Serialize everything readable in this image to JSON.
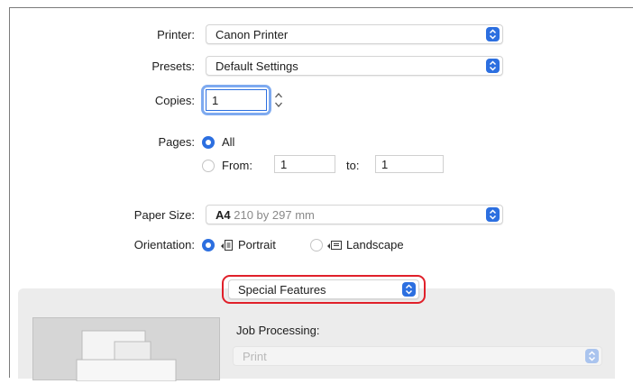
{
  "printer": {
    "label": "Printer:",
    "value": "Canon Printer"
  },
  "presets": {
    "label": "Presets:",
    "value": "Default Settings"
  },
  "copies": {
    "label": "Copies:",
    "value": "1"
  },
  "pages": {
    "label": "Pages:",
    "all": "All",
    "from_label": "From:",
    "from_value": "1",
    "to_label": "to:",
    "to_value": "1"
  },
  "paper_size": {
    "label": "Paper Size:",
    "size": "A4",
    "detail": "210 by 297 mm"
  },
  "orientation": {
    "label": "Orientation:",
    "portrait": "Portrait",
    "landscape": "Landscape"
  },
  "section_popup": {
    "value": "Special Features"
  },
  "job_processing": {
    "label": "Job Processing:",
    "value": "Print"
  },
  "colors": {
    "accent": "#2c6fe0",
    "highlight": "#e0202a",
    "panel": "#ececec"
  }
}
